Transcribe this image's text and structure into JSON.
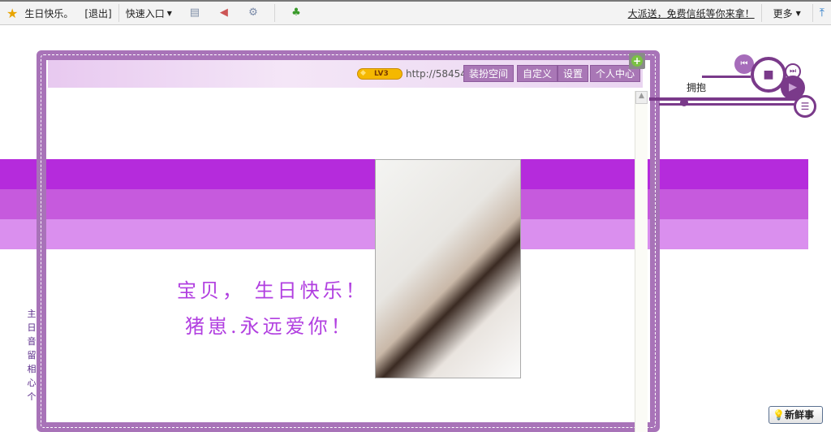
{
  "topbar": {
    "username": "生日快乐。",
    "logout": "[退出]",
    "quick_entry": "快速入口",
    "promo": "大派送，免费信纸等你来拿！",
    "more": "更多"
  },
  "space": {
    "level": "LV3",
    "url": "http://58454",
    "buttons": [
      "装扮空间",
      "自定义",
      "设置",
      "个人中心"
    ]
  },
  "player": {
    "song": "拥抱"
  },
  "greeting": {
    "line1": "宝贝， 生日快乐！",
    "line2": "猪崽.永远爱你！"
  },
  "sidebar": {
    "chars": [
      "主",
      "日",
      "音",
      "留",
      "相",
      "心",
      "个"
    ]
  },
  "news_button": "新鲜事",
  "colors": {
    "frame": "#a873b8",
    "stripe1": "#b52bdc",
    "stripe2": "#c65add",
    "stripe3": "#da8fee",
    "text_purple": "#b13fe0"
  }
}
